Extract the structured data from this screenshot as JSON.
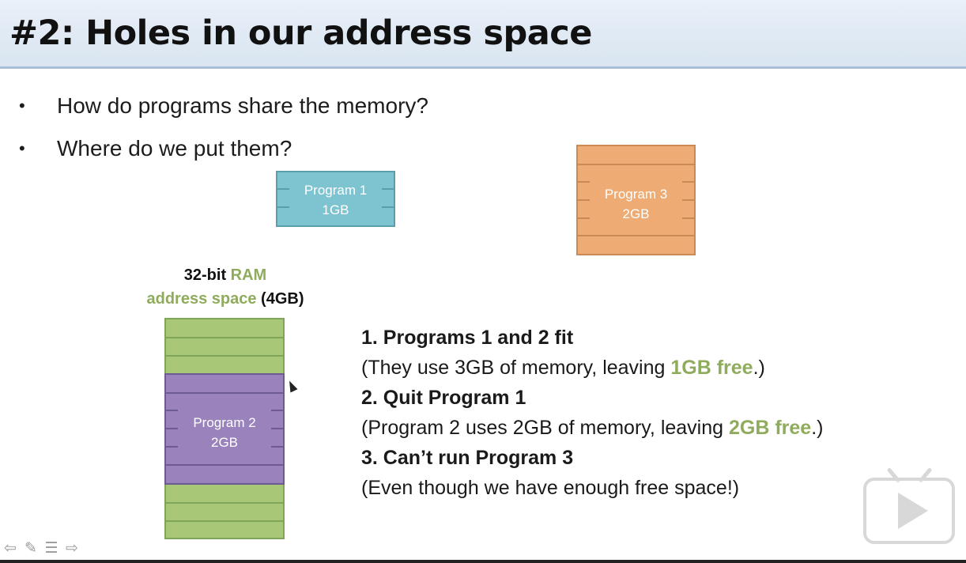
{
  "slide": {
    "title": "#2: Holes in our address space",
    "bullets": [
      "How do programs share the memory?",
      "Where do we put them?"
    ]
  },
  "program1": {
    "name": "Program 1",
    "size": "1GB"
  },
  "program2": {
    "name": "Program 2",
    "size": "2GB"
  },
  "program3": {
    "name": "Program 3",
    "size": "2GB"
  },
  "ram_label": {
    "part1": "32-bit",
    "part2": "RAM",
    "part3": "address space",
    "part4": "(4GB)"
  },
  "steps": {
    "s1_head": "1. Programs 1 and 2 fit",
    "s1_pre": "(They use 3GB of memory, leaving ",
    "s1_hl": "1GB free",
    "s1_post": ".)",
    "s2_head": "2. Quit Program 1",
    "s2_pre": "(Program 2 uses 2GB of memory, leaving ",
    "s2_hl": "2GB free",
    "s2_post": ".)",
    "s3_head": "3. Can’t run Program 3",
    "s3_body": "(Even though we have enough free space!)"
  },
  "icons": {
    "nav": [
      "arrow-left-icon",
      "pen-icon",
      "menu-icon",
      "arrow-right-icon"
    ],
    "overlay": "play-button-icon"
  },
  "colors": {
    "program1": "#7dc3d0",
    "program2": "#9a83bd",
    "program3": "#eeab73",
    "ram": "#a9c877",
    "highlight_green": "#8fac5c"
  }
}
